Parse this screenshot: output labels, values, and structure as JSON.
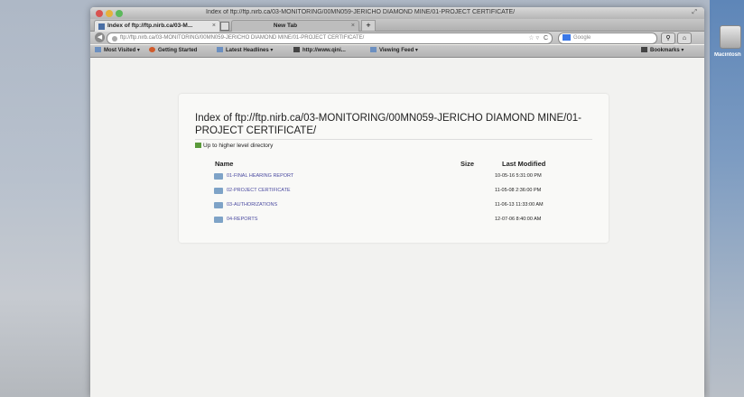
{
  "window": {
    "title": "Index of ftp://ftp.nirb.ca/03-MONITORING/00MN059-JERICHO DIAMOND MINE/01-PROJECT CERTIFICATE/"
  },
  "desktop": {
    "drive_label": "Macintosh"
  },
  "tabs": [
    {
      "label": "Index of ftp://ftp.nirb.ca/03-M...",
      "active": true
    },
    {
      "label": "New Tab",
      "active": false
    }
  ],
  "new_tab_label": "+",
  "navbar": {
    "url": "ftp://ftp.nirb.ca/03-MONITORING/00MN059-JERICHO DIAMOND MINE/01-PROJECT CERTIFICATE/",
    "search_placeholder": "Google"
  },
  "bookmarks": {
    "items": [
      {
        "label": "Most Visited ▾"
      },
      {
        "label": "Getting Started"
      },
      {
        "label": "Latest Headlines ▾"
      },
      {
        "label": "http://www.qini..."
      },
      {
        "label": "Viewing Feed ▾"
      }
    ],
    "right_label": "Bookmarks ▾"
  },
  "listing": {
    "title": "Index of ftp://ftp.nirb.ca/03-MONITORING/00MN059-JERICHO DIAMOND MINE/01-PROJECT CERTIFICATE/",
    "up_link": "Up to higher level directory",
    "columns": {
      "name": "Name",
      "size": "Size",
      "modified": "Last Modified"
    },
    "rows": [
      {
        "name": "01-FINAL HEARING REPORT",
        "date": "10-05-16   5:31:00 PM"
      },
      {
        "name": "02-PROJECT CERTIFICATE",
        "date": "11-05-08   2:36:00 PM"
      },
      {
        "name": "03-AUTHORIZATIONS",
        "date": "11-06-13   11:33:00 AM"
      },
      {
        "name": "04-REPORTS",
        "date": "12-07-06   8:40:00 AM"
      }
    ]
  }
}
